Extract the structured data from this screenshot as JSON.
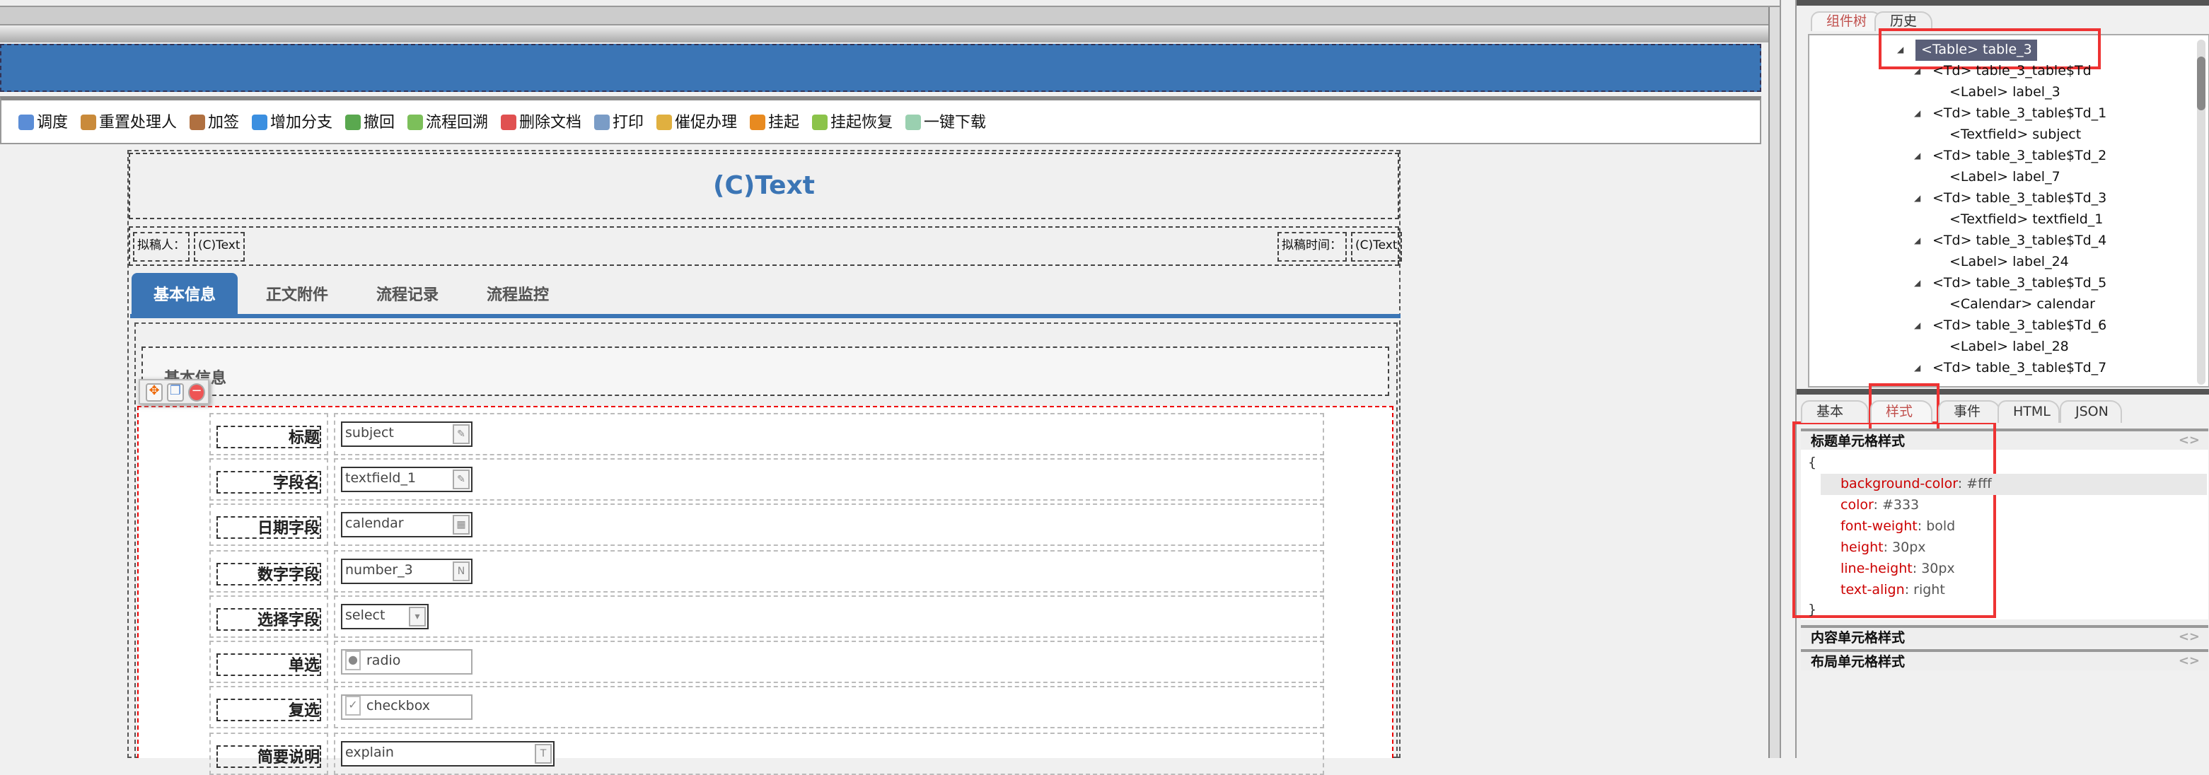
{
  "toolbar": {
    "items": [
      {
        "label": "调度",
        "icon": "dispatch-icon",
        "color": "#5b8dd6"
      },
      {
        "label": "重置处理人",
        "icon": "reset-handler-icon",
        "color": "#c98a3a"
      },
      {
        "label": "加签",
        "icon": "add-signer-icon",
        "color": "#b07040"
      },
      {
        "label": "增加分支",
        "icon": "add-branch-icon",
        "color": "#3b8fe0"
      },
      {
        "label": "撤回",
        "icon": "withdraw-icon",
        "color": "#5aa84f"
      },
      {
        "label": "流程回溯",
        "icon": "process-trace-icon",
        "color": "#7cbf5a"
      },
      {
        "label": "删除文档",
        "icon": "delete-doc-icon",
        "color": "#e05050"
      },
      {
        "label": "打印",
        "icon": "print-icon",
        "color": "#7a9cc6"
      },
      {
        "label": "催促办理",
        "icon": "urge-icon",
        "color": "#e0b040"
      },
      {
        "label": "挂起",
        "icon": "suspend-icon",
        "color": "#e88a20"
      },
      {
        "label": "挂起恢复",
        "icon": "resume-icon",
        "color": "#8bc34a"
      },
      {
        "label": "一键下载",
        "icon": "download-icon",
        "color": "#9ad0b0"
      }
    ]
  },
  "form": {
    "title": "(C)Text",
    "drafter_label": "拟稿人：",
    "drafter_value": "(C)Text",
    "draft_time_label": "拟稿时间：",
    "draft_time_value": "(C)Text",
    "tabs": [
      "基本信息",
      "正文附件",
      "流程记录",
      "流程监控"
    ],
    "section_title": "基本信息",
    "fields": [
      {
        "label": "标题",
        "value": "subject",
        "icon": "text-edit-icon"
      },
      {
        "label": "字段名",
        "value": "textfield_1",
        "icon": "text-edit-icon"
      },
      {
        "label": "日期字段",
        "value": "calendar",
        "icon": "calendar-icon"
      },
      {
        "label": "数字字段",
        "value": "number_3",
        "icon": "number-icon"
      },
      {
        "label": "选择字段",
        "value": "select",
        "icon": "dropdown-icon"
      },
      {
        "label": "单选",
        "value": "radio",
        "icon": "radio-icon"
      },
      {
        "label": "复选",
        "value": "checkbox",
        "icon": "checkbox-icon"
      },
      {
        "label": "简要说明",
        "value": "explain",
        "icon": "textarea-icon"
      }
    ]
  },
  "right_panel": {
    "top_tabs": [
      "组件树",
      "历史"
    ],
    "tree": [
      {
        "text": "<Table> table_3",
        "level": 0,
        "selected": true
      },
      {
        "text": "<Td> table_3_table$Td",
        "level": 1
      },
      {
        "text": "<Label> label_3",
        "level": 2
      },
      {
        "text": "<Td> table_3_table$Td_1",
        "level": 1
      },
      {
        "text": "<Textfield> subject",
        "level": 2
      },
      {
        "text": "<Td> table_3_table$Td_2",
        "level": 1
      },
      {
        "text": "<Label> label_7",
        "level": 2
      },
      {
        "text": "<Td> table_3_table$Td_3",
        "level": 1
      },
      {
        "text": "<Textfield> textfield_1",
        "level": 2
      },
      {
        "text": "<Td> table_3_table$Td_4",
        "level": 1
      },
      {
        "text": "<Label> label_24",
        "level": 2
      },
      {
        "text": "<Td> table_3_table$Td_5",
        "level": 1
      },
      {
        "text": "<Calendar> calendar",
        "level": 2
      },
      {
        "text": "<Td> table_3_table$Td_6",
        "level": 1
      },
      {
        "text": "<Label> label_28",
        "level": 2
      },
      {
        "text": "<Td> table_3_table$Td_7",
        "level": 1
      }
    ],
    "bottom_tabs": [
      "基本",
      "样式",
      "事件",
      "HTML",
      "JSON"
    ],
    "sections": [
      "标题单元格样式",
      "内容单元格样式",
      "布局单元格样式"
    ],
    "css_open": "{",
    "css_close": "}",
    "css_props": [
      {
        "key": "background-color",
        "value": "#fff"
      },
      {
        "key": "color",
        "value": "#333"
      },
      {
        "key": "font-weight",
        "value": "bold"
      },
      {
        "key": "height",
        "value": "30px"
      },
      {
        "key": "line-height",
        "value": "30px"
      },
      {
        "key": "text-align",
        "value": "right"
      }
    ],
    "toggle_glyph": "<>"
  }
}
